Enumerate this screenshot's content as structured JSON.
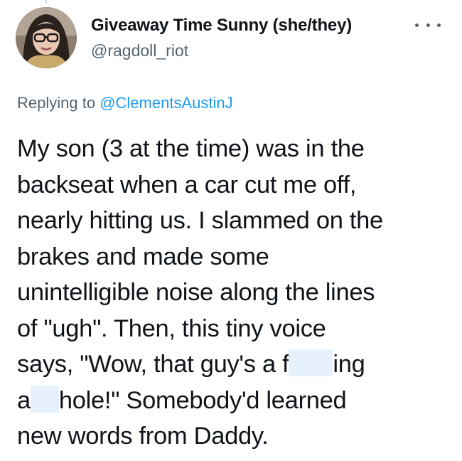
{
  "author": {
    "display_name": "Giveaway Time Sunny (she/they)",
    "handle": "@ragdoll_riot",
    "avatar_icon": "user-avatar-photo"
  },
  "reply": {
    "prefix": "Replying to",
    "mention": "@ClementsAustinJ"
  },
  "tweet": {
    "lines": [
      "My son (3 at the time) was in the",
      "backseat when a car cut me off,",
      "nearly hitting us. I slammed on the",
      "brakes and made some",
      "unintelligible noise along the lines",
      "of \"ugh\". Then, this tiny voice",
      {
        "before": "says, \"Wow, that guy's a f",
        "after": "ing"
      },
      {
        "before": "a",
        "after": "hole!\" Somebody'd learned"
      },
      "new words from Daddy."
    ]
  },
  "icons": {
    "more": "more-options-icon"
  },
  "colors": {
    "text": "#0f1419",
    "secondary": "#536471",
    "link": "#1d9bf0",
    "redaction": "#e6f1fb"
  }
}
